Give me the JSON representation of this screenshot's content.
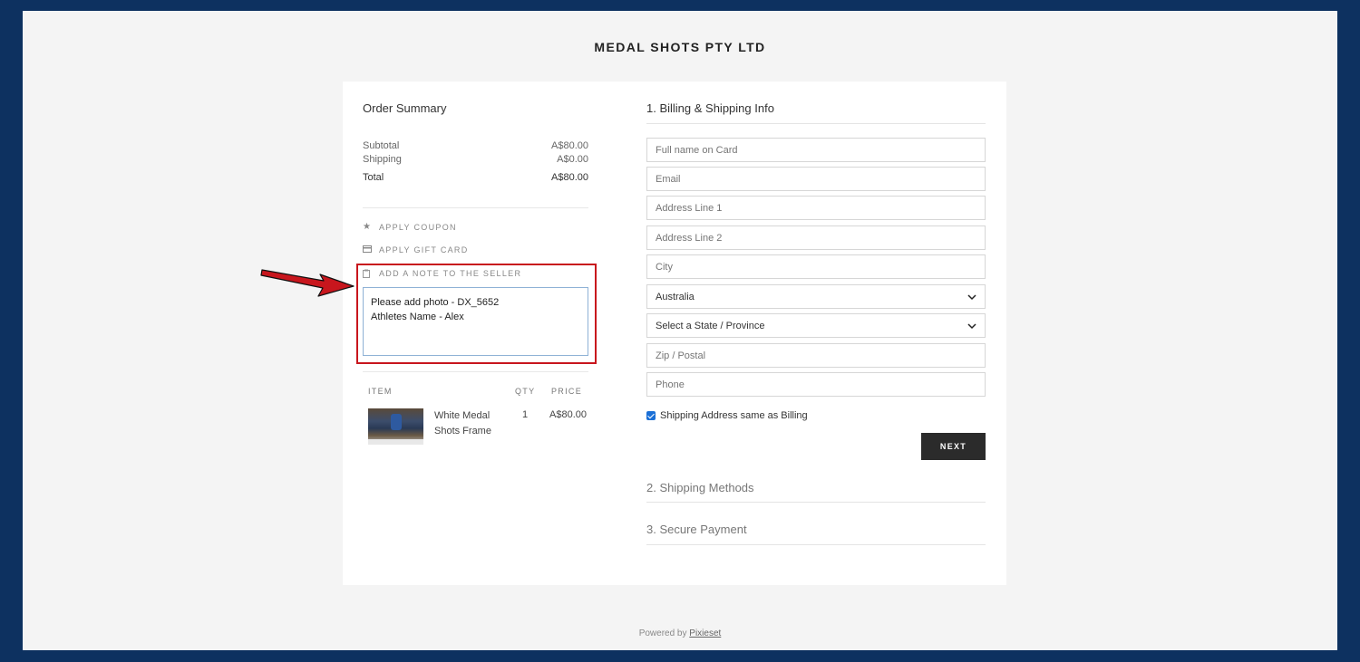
{
  "brand": "MEDAL SHOTS PTY LTD",
  "summary": {
    "title": "Order Summary",
    "subtotal_label": "Subtotal",
    "subtotal_value": "A$80.00",
    "shipping_label": "Shipping",
    "shipping_value": "A$0.00",
    "total_label": "Total",
    "total_value": "A$80.00"
  },
  "links": {
    "coupon": "APPLY COUPON",
    "gift_card": "APPLY GIFT CARD",
    "note": "ADD A NOTE TO THE SELLER"
  },
  "note_text": "Please add photo - DX_5652\nAthletes Name - Alex",
  "items_table": {
    "headers": {
      "item": "ITEM",
      "qty": "QTY",
      "price": "PRICE"
    },
    "rows": [
      {
        "name": "White Medal Shots Frame",
        "qty": "1",
        "price": "A$80.00"
      }
    ]
  },
  "billing": {
    "title": "1. Billing & Shipping Info",
    "placeholders": {
      "full_name": "Full name on Card",
      "email": "Email",
      "address1": "Address Line 1",
      "address2": "Address Line 2",
      "city": "City",
      "zip": "Zip / Postal",
      "phone": "Phone"
    },
    "country": "Australia",
    "state": "Select a State / Province",
    "same_address_label": "Shipping Address same as Billing",
    "same_address_checked": true,
    "next_label": "NEXT"
  },
  "sections": {
    "shipping_methods": "2. Shipping Methods",
    "secure_payment": "3. Secure Payment"
  },
  "footer": {
    "prefix": "Powered by",
    "link": "Pixieset"
  },
  "colors": {
    "frame": "#0d3160",
    "highlight": "#c8161d",
    "button": "#2b2b2b",
    "checkbox": "#1a6fd6"
  }
}
